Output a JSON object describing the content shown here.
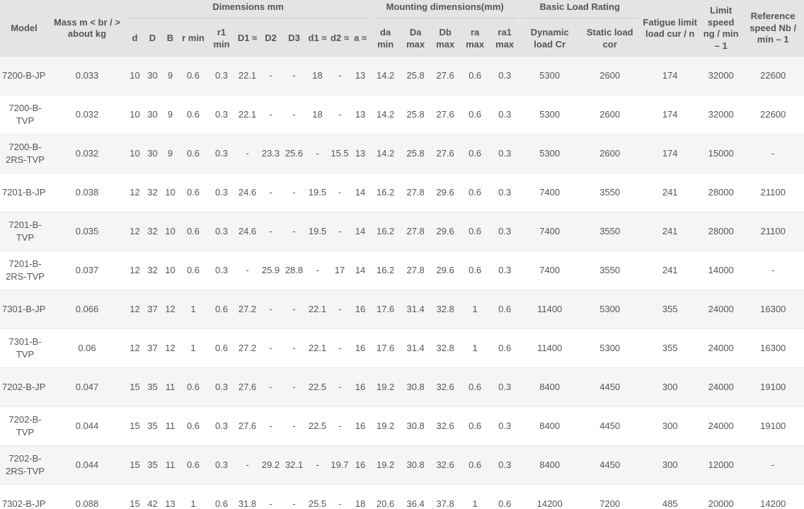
{
  "headers": {
    "model": "Model",
    "mass": "Mass m < br / > about kg",
    "dimensions_group": "Dimensions mm",
    "mounting_group": "Mounting dimensions(mm)",
    "load_group": "Basic Load Rating",
    "fatigue": "Fatigue limit load cur / n",
    "limit_speed": "Limit speed ng / min – 1",
    "reference_speed": "Reference speed Nb / min – 1",
    "dims": [
      "d",
      "D",
      "B",
      "r min",
      "r1 min",
      "D1 ≈",
      "D2",
      "D3",
      "d1 ≈",
      "d2 ≈",
      "a ≈"
    ],
    "mounting": [
      "da min",
      "Da max",
      "Db max",
      "ra max",
      "ra1 max"
    ],
    "load": [
      "Dynamic load Cr",
      "Static load cor"
    ]
  },
  "rows": [
    [
      "7200-B-JP",
      "0.033",
      "10",
      "30",
      "9",
      "0.6",
      "0.3",
      "22.1",
      "-",
      "-",
      "18",
      "-",
      "13",
      "14.2",
      "25.8",
      "27.6",
      "0.6",
      "0.3",
      "5300",
      "2600",
      "174",
      "32000",
      "22600"
    ],
    [
      "7200-B-TVP",
      "0.032",
      "10",
      "30",
      "9",
      "0.6",
      "0.3",
      "22.1",
      "-",
      "-",
      "18",
      "-",
      "13",
      "14.2",
      "25.8",
      "27.6",
      "0.6",
      "0.3",
      "5300",
      "2600",
      "174",
      "32000",
      "22600"
    ],
    [
      "7200-B-2RS-TVP",
      "0.032",
      "10",
      "30",
      "9",
      "0.6",
      "0.3",
      "-",
      "23.3",
      "25.6",
      "-",
      "15.5",
      "13",
      "14.2",
      "25.8",
      "27.6",
      "0.6",
      "0.3",
      "5300",
      "2600",
      "174",
      "15000",
      "-"
    ],
    [
      "7201-B-JP",
      "0.038",
      "12",
      "32",
      "10",
      "0.6",
      "0.3",
      "24.6",
      "-",
      "-",
      "19.5",
      "-",
      "14",
      "16.2",
      "27.8",
      "29.6",
      "0.6",
      "0.3",
      "7400",
      "3550",
      "241",
      "28000",
      "21100"
    ],
    [
      "7201-B-TVP",
      "0.035",
      "12",
      "32",
      "10",
      "0.6",
      "0.3",
      "24.6",
      "-",
      "-",
      "19.5",
      "-",
      "14",
      "16.2",
      "27.8",
      "29.6",
      "0.6",
      "0.3",
      "7400",
      "3550",
      "241",
      "28000",
      "21100"
    ],
    [
      "7201-B-2RS-TVP",
      "0.037",
      "12",
      "32",
      "10",
      "0.6",
      "0.3",
      "-",
      "25.9",
      "28.8",
      "-",
      "17",
      "14",
      "16.2",
      "27.8",
      "29.6",
      "0.6",
      "0.3",
      "7400",
      "3550",
      "241",
      "14000",
      "-"
    ],
    [
      "7301-B-JP",
      "0.066",
      "12",
      "37",
      "12",
      "1",
      "0.6",
      "27.2",
      "-",
      "-",
      "22.1",
      "-",
      "16",
      "17.6",
      "31.4",
      "32.8",
      "1",
      "0.6",
      "11400",
      "5300",
      "355",
      "24000",
      "16300"
    ],
    [
      "7301-B-TVP",
      "0.06",
      "12",
      "37",
      "12",
      "1",
      "0.6",
      "27.2",
      "-",
      "-",
      "22.1",
      "-",
      "16",
      "17.6",
      "31.4",
      "32.8",
      "1",
      "0.6",
      "11400",
      "5300",
      "355",
      "24000",
      "16300"
    ],
    [
      "7202-B-JP",
      "0.047",
      "15",
      "35",
      "11",
      "0.6",
      "0.3",
      "27.6",
      "-",
      "-",
      "22.5",
      "-",
      "16",
      "19.2",
      "30.8",
      "32.6",
      "0.6",
      "0.3",
      "8400",
      "4450",
      "300",
      "24000",
      "19100"
    ],
    [
      "7202-B-TVP",
      "0.044",
      "15",
      "35",
      "11",
      "0.6",
      "0.3",
      "27.6",
      "-",
      "-",
      "22.5",
      "-",
      "16",
      "19.2",
      "30.8",
      "32.6",
      "0.6",
      "0.3",
      "8400",
      "4450",
      "300",
      "24000",
      "19100"
    ],
    [
      "7202-B-2RS-TVP",
      "0.044",
      "15",
      "35",
      "11",
      "0.6",
      "0.3",
      "-",
      "29.2",
      "32.1",
      "-",
      "19.7",
      "16",
      "19.2",
      "30.8",
      "32.6",
      "0.6",
      "0.3",
      "8400",
      "4450",
      "300",
      "12000",
      "-"
    ],
    [
      "7302-B-JP",
      "0.088",
      "15",
      "42",
      "13",
      "1",
      "0.6",
      "31.8",
      "-",
      "-",
      "25.5",
      "-",
      "18",
      "20.6",
      "36.4",
      "37.8",
      "1",
      "0.6",
      "14200",
      "7200",
      "485",
      "20000",
      "14200"
    ]
  ],
  "colors": {
    "header_bg": "#e4e4e4",
    "row_alt_bg": "#f5f5f5",
    "text": "#555555"
  }
}
